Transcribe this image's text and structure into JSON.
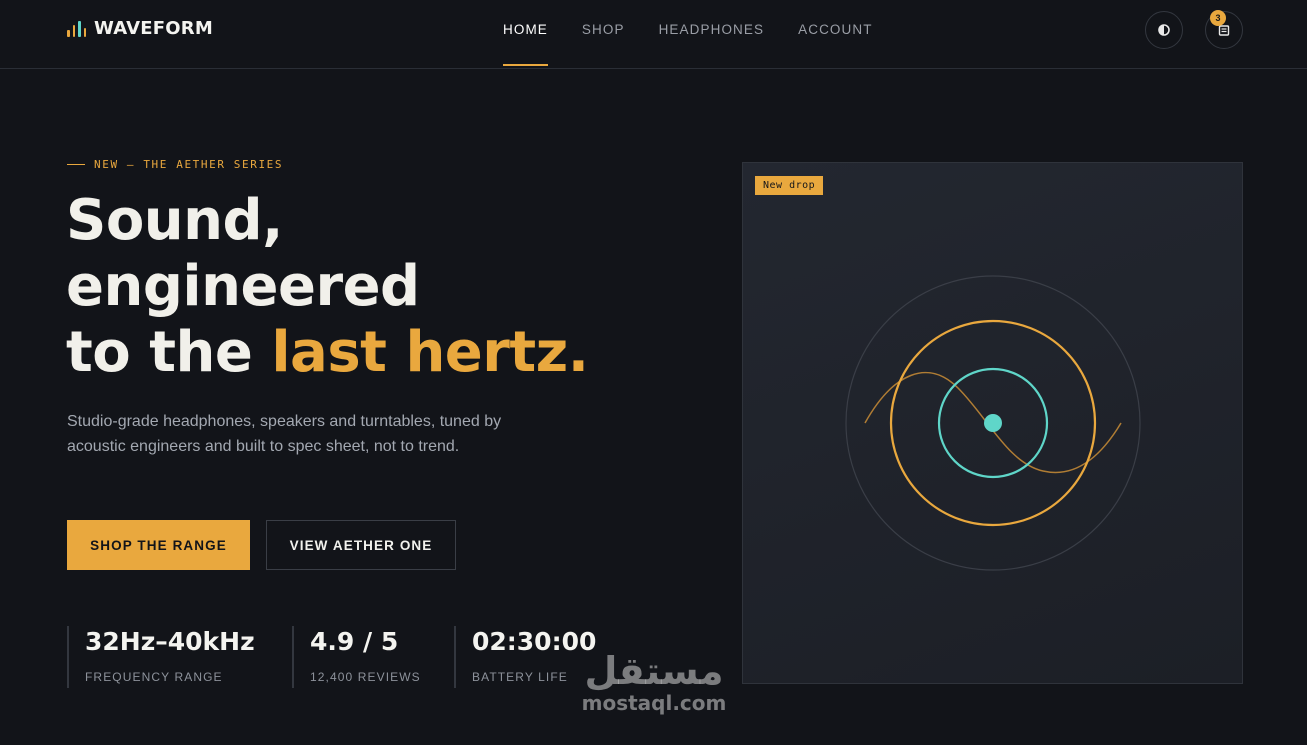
{
  "brand": {
    "name": "WAVEFORM",
    "bar_colors": [
      "#e9a83e",
      "#e9a83e",
      "#5fd6c9",
      "#e9a83e"
    ]
  },
  "nav": {
    "items": [
      {
        "label": "HOME",
        "active": true
      },
      {
        "label": "SHOP",
        "active": false
      },
      {
        "label": "HEADPHONES",
        "active": false
      },
      {
        "label": "ACCOUNT",
        "active": false
      }
    ]
  },
  "header_actions": {
    "theme_icon": "contrast-icon",
    "cart_icon": "cart-icon",
    "cart_count": "3"
  },
  "hero": {
    "eyebrow": "NEW — THE AETHER SERIES",
    "headline_line1": "Sound,",
    "headline_line2": "engineered",
    "headline_line3_plain": "to the ",
    "headline_line3_accent": "last hertz.",
    "subcopy": "Studio-grade headphones, speakers and turntables, tuned by acoustic engineers and built to spec sheet, not to trend.",
    "primary_button": "SHOP THE RANGE",
    "secondary_button": "VIEW AETHER ONE"
  },
  "stats": [
    {
      "value": "32Hz–40kHz",
      "label": "FREQUENCY RANGE"
    },
    {
      "value": "4.9 / 5",
      "label": "12,400 REVIEWS"
    },
    {
      "value": "02:30:00",
      "label": "BATTERY LIFE"
    }
  ],
  "visual": {
    "badge": "New drop"
  },
  "watermark": {
    "arabic": "مستقل",
    "latin": "mostaql.com"
  },
  "colors": {
    "background": "#121419",
    "accent": "#e9a83e",
    "teal": "#5fd6c9",
    "muted_text": "#a3a8b1"
  }
}
